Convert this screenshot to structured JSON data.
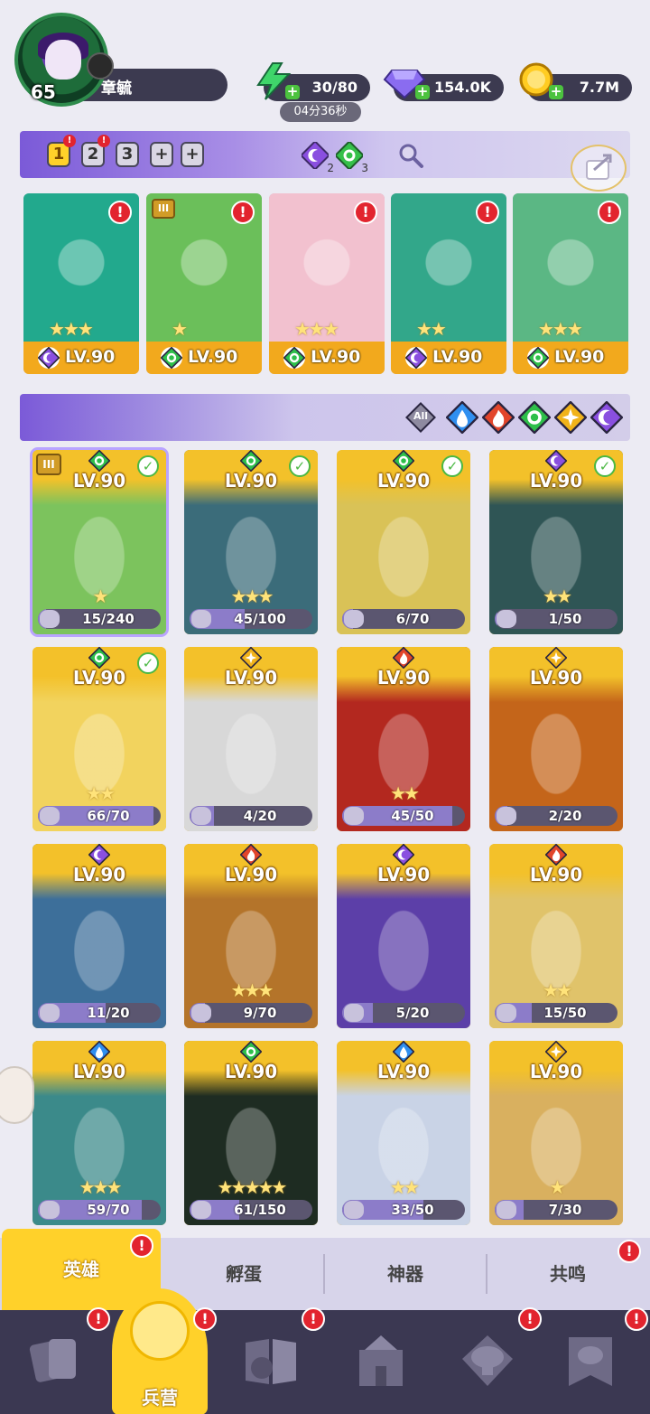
{
  "player": {
    "level": "65",
    "name": "章毓"
  },
  "resources": {
    "energy": "30/80",
    "energy_timer": "04分36秒",
    "gems": "154.0K",
    "gold": "7.7M"
  },
  "teams": {
    "tabs": [
      "1",
      "2",
      "3",
      "+",
      "+"
    ],
    "active_index": 0,
    "alerts_on": [
      0,
      1
    ],
    "element_counts": [
      {
        "element": "shadow",
        "color": "#8a4fe0",
        "count": "2"
      },
      {
        "element": "nature",
        "color": "#35c04a",
        "count": "3"
      }
    ]
  },
  "team_cards": [
    {
      "level": "LV.90",
      "element": "shadow",
      "stars": "★★★",
      "tier": "",
      "bg": "#22a98d"
    },
    {
      "level": "LV.90",
      "element": "nature",
      "stars": "★",
      "tier": "III",
      "bg": "#6bbf5a"
    },
    {
      "level": "LV.90",
      "element": "nature",
      "stars": "★★★",
      "tier": "",
      "bg": "#f2c1cf"
    },
    {
      "level": "LV.90",
      "element": "shadow",
      "stars": "★★",
      "tier": "",
      "bg": "#32a78a"
    },
    {
      "level": "LV.90",
      "element": "nature",
      "stars": "★★★",
      "tier": "",
      "bg": "#5bb784"
    }
  ],
  "filters": [
    {
      "name": "all",
      "label": "All",
      "color": "#8e8aa0"
    },
    {
      "name": "water",
      "label": "",
      "color": "#2f8ff0"
    },
    {
      "name": "fire",
      "label": "",
      "color": "#e2452b"
    },
    {
      "name": "nature",
      "label": "",
      "color": "#2ebf4a"
    },
    {
      "name": "light",
      "label": "",
      "color": "#f1b319"
    },
    {
      "name": "shadow",
      "label": "",
      "color": "#8a4fe0"
    }
  ],
  "heroes": [
    {
      "level": "LV.90",
      "element": "nature",
      "progress": "15/240",
      "fraction": 0.0625,
      "stars": "★",
      "checked": true,
      "selected": true,
      "tier": "III",
      "bg": "#7cc35d"
    },
    {
      "level": "LV.90",
      "element": "nature",
      "progress": "45/100",
      "fraction": 0.45,
      "stars": "★★★",
      "checked": true,
      "selected": false,
      "tier": "",
      "bg": "#3b6c7a"
    },
    {
      "level": "LV.90",
      "element": "nature",
      "progress": "6/70",
      "fraction": 0.0857,
      "stars": "",
      "checked": true,
      "selected": false,
      "tier": "",
      "bg": "#d9c257"
    },
    {
      "level": "LV.90",
      "element": "shadow",
      "progress": "1/50",
      "fraction": 0.02,
      "stars": "★★",
      "checked": true,
      "selected": false,
      "tier": "",
      "bg": "#2f5555"
    },
    {
      "level": "LV.90",
      "element": "nature",
      "progress": "66/70",
      "fraction": 0.943,
      "stars": "★★",
      "checked": true,
      "selected": false,
      "tier": "",
      "bg": "#f2d35e"
    },
    {
      "level": "LV.90",
      "element": "light",
      "progress": "4/20",
      "fraction": 0.2,
      "stars": "",
      "checked": false,
      "selected": false,
      "tier": "",
      "bg": "#d8d8d8"
    },
    {
      "level": "LV.90",
      "element": "fire",
      "progress": "45/50",
      "fraction": 0.9,
      "stars": "★★",
      "checked": false,
      "selected": false,
      "tier": "",
      "bg": "#b3281f"
    },
    {
      "level": "LV.90",
      "element": "light",
      "progress": "2/20",
      "fraction": 0.1,
      "stars": "",
      "checked": false,
      "selected": false,
      "tier": "",
      "bg": "#c4651a"
    },
    {
      "level": "LV.90",
      "element": "shadow",
      "progress": "11/20",
      "fraction": 0.55,
      "stars": "",
      "checked": false,
      "selected": false,
      "tier": "",
      "bg": "#3d6f9a"
    },
    {
      "level": "LV.90",
      "element": "fire",
      "progress": "9/70",
      "fraction": 0.1286,
      "stars": "★★★",
      "checked": false,
      "selected": false,
      "tier": "",
      "bg": "#b4742a"
    },
    {
      "level": "LV.90",
      "element": "shadow",
      "progress": "5/20",
      "fraction": 0.25,
      "stars": "",
      "checked": false,
      "selected": false,
      "tier": "",
      "bg": "#5c3fa8"
    },
    {
      "level": "LV.90",
      "element": "fire",
      "progress": "15/50",
      "fraction": 0.3,
      "stars": "★★",
      "checked": false,
      "selected": false,
      "tier": "",
      "bg": "#e0c36a"
    },
    {
      "level": "LV.90",
      "element": "water",
      "progress": "59/70",
      "fraction": 0.843,
      "stars": "★★★",
      "checked": false,
      "selected": false,
      "tier": "",
      "bg": "#3b8a8a"
    },
    {
      "level": "LV.90",
      "element": "nature",
      "progress": "61/150",
      "fraction": 0.407,
      "stars": "★★★★★",
      "checked": false,
      "selected": false,
      "tier": "",
      "bg": "#1e2c22"
    },
    {
      "level": "LV.90",
      "element": "water",
      "progress": "33/50",
      "fraction": 0.66,
      "stars": "★★",
      "checked": false,
      "selected": false,
      "tier": "",
      "bg": "#c9d3e6"
    },
    {
      "level": "LV.90",
      "element": "light",
      "progress": "7/30",
      "fraction": 0.233,
      "stars": "★",
      "checked": false,
      "selected": false,
      "tier": "",
      "bg": "#d9b05f"
    }
  ],
  "element_colors": {
    "water": "#2f8ff0",
    "fire": "#e2452b",
    "nature": "#2ebf4a",
    "light": "#f1b319",
    "shadow": "#8a4fe0"
  },
  "sub_tabs": [
    {
      "label": "英雄",
      "active": true,
      "alert": true
    },
    {
      "label": "孵蛋",
      "active": false,
      "alert": false
    },
    {
      "label": "神器",
      "active": false,
      "alert": false
    },
    {
      "label": "共鸣",
      "active": false,
      "alert": true
    }
  ],
  "nav": [
    {
      "name": "cards",
      "label": "",
      "alert": true
    },
    {
      "name": "barracks",
      "label": "兵营",
      "alert": true,
      "active": true
    },
    {
      "name": "quests",
      "label": "",
      "alert": true
    },
    {
      "name": "castle",
      "label": "",
      "alert": false
    },
    {
      "name": "guild",
      "label": "",
      "alert": true
    },
    {
      "name": "guild-banner",
      "label": "",
      "alert": true
    }
  ],
  "alert_mark": "!"
}
